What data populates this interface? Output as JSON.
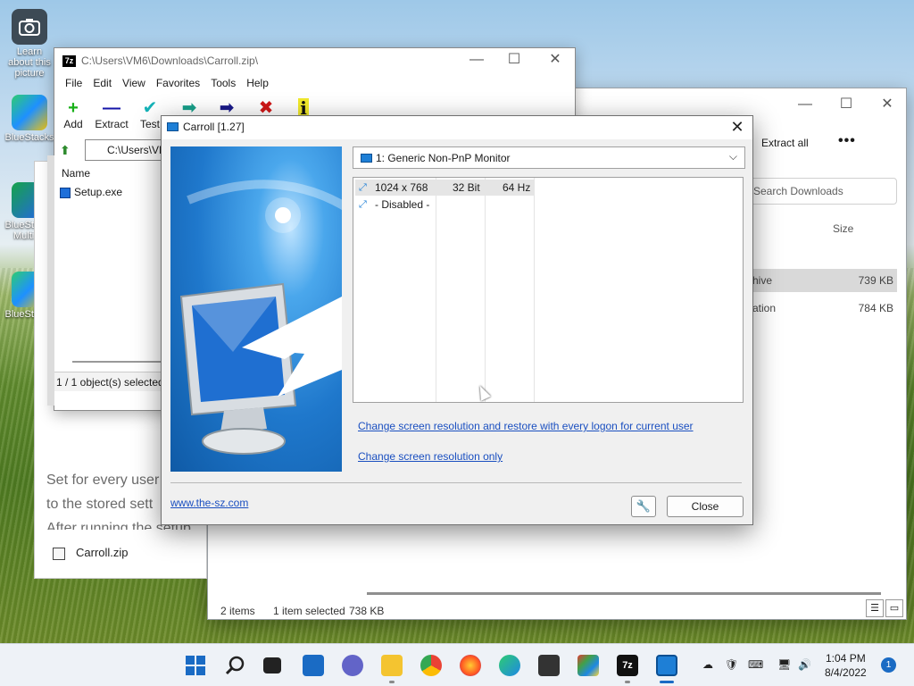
{
  "desktop": {
    "icons": [
      {
        "label": "Learn about this picture"
      },
      {
        "label": "BlueStacks"
      },
      {
        "label": "BlueStacks Multi-..."
      },
      {
        "label": "BlueStacks"
      }
    ]
  },
  "explorer": {
    "extract_all": "Extract all",
    "more": "•••",
    "search_placeholder": "Search Downloads",
    "size_header": "Size",
    "rows": [
      {
        "type": "chive",
        "size": "739 KB"
      },
      {
        "type": "cation",
        "size": "784 KB"
      }
    ],
    "status": {
      "items": "2 items",
      "selected": "1 item selected",
      "size": "738 KB"
    }
  },
  "doc_panel": {
    "line1": "Set for every user",
    "line2": "to the stored sett",
    "line3": "After running the setup",
    "file": "Carroll.zip"
  },
  "sevenzip": {
    "title": "C:\\Users\\VM6\\Downloads\\Carroll.zip\\",
    "logo": "7z",
    "menu": [
      "File",
      "Edit",
      "View",
      "Favorites",
      "Tools",
      "Help"
    ],
    "tools": [
      {
        "label": "Add",
        "glyph": "+"
      },
      {
        "label": "Extract",
        "glyph": "—"
      },
      {
        "label": "Test",
        "glyph": "✔"
      },
      {
        "label": "",
        "glyph": "➡"
      },
      {
        "label": "",
        "glyph": "➡"
      },
      {
        "label": "",
        "glyph": "✖"
      },
      {
        "label": "",
        "glyph": "i"
      }
    ],
    "address": "C:\\Users\\VM6",
    "column_name": "Name",
    "file": "Setup.exe",
    "status": "1 / 1 object(s) selected"
  },
  "carroll": {
    "title": "Carroll [1.27]",
    "monitor": "1: Generic Non-PnP Monitor",
    "modes": [
      {
        "res": "1024 x 768",
        "bits": "32 Bit",
        "hz": "64 Hz"
      },
      {
        "res": "- Disabled -",
        "bits": "",
        "hz": ""
      }
    ],
    "link_restore": "Change screen resolution and restore with every logon for current user",
    "link_only": "Change screen resolution only",
    "website": "www.the-sz.com",
    "tools_icon": "🔧",
    "close_button": "Close"
  },
  "taskbar": {
    "time": "1:04 PM",
    "date": "8/4/2022",
    "notifications": "1"
  },
  "colors": {
    "accent": "#1a6bc4",
    "link": "#1a4fc0"
  }
}
